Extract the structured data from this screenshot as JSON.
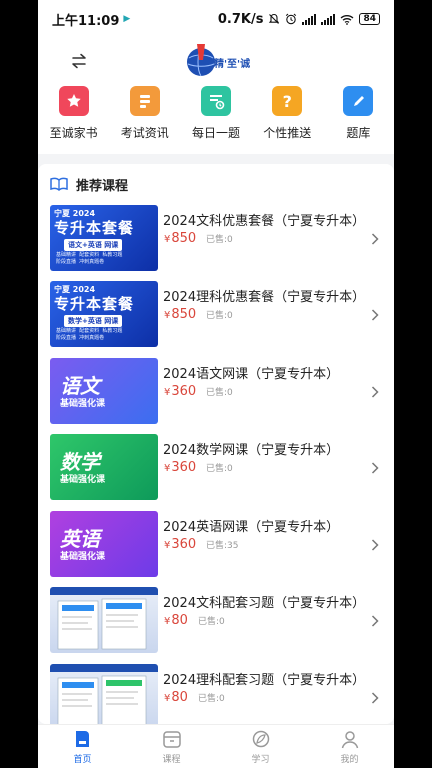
{
  "status": {
    "time": "上午11:09",
    "speed": "0.7K/s",
    "battery": "84"
  },
  "header": {
    "logo_text": "精'至'诚"
  },
  "quicknav": [
    {
      "label": "至诚家书",
      "icon": "star-book-icon",
      "color": "#f0475b"
    },
    {
      "label": "考试资讯",
      "icon": "news-icon",
      "color": "#f39a3b"
    },
    {
      "label": "每日一题",
      "icon": "daily-question-icon",
      "color": "#2ec4a0"
    },
    {
      "label": "个性推送",
      "icon": "question-mark-icon",
      "color": "#f5a623"
    },
    {
      "label": "题库",
      "icon": "pencil-book-icon",
      "color": "#2e8ef0"
    }
  ],
  "recommend": {
    "title": "推荐课程"
  },
  "courses": [
    {
      "title": "2024文科优惠套餐（宁夏专升本）",
      "price": "850",
      "currency": "¥",
      "sold": "已售:0",
      "thumb": {
        "top": "宁夏 2024",
        "big": "专升本套餐",
        "tag": "语文+英语 网课",
        "lines": "基础精讲  配套资料  私教习题\n阶段直播  冲刺真题卷"
      }
    },
    {
      "title": "2024理科优惠套餐（宁夏专升本）",
      "price": "850",
      "currency": "¥",
      "sold": "已售:0",
      "thumb": {
        "top": "宁夏 2024",
        "big": "专升本套餐",
        "tag": "数学+英语 网课",
        "lines": "基础精讲  配套资料  私教习题\n阶段直播  冲刺真题卷"
      }
    },
    {
      "title": "2024语文网课（宁夏专升本）",
      "price": "360",
      "currency": "¥",
      "sold": "已售:0",
      "thumb": {
        "subject": "语文",
        "sub": "基础强化课"
      }
    },
    {
      "title": "2024数学网课（宁夏专升本）",
      "price": "360",
      "currency": "¥",
      "sold": "已售:0",
      "thumb": {
        "subject": "数学",
        "sub": "基础强化课"
      }
    },
    {
      "title": "2024英语网课（宁夏专升本）",
      "price": "360",
      "currency": "¥",
      "sold": "已售:35",
      "thumb": {
        "subject": "英语",
        "sub": "基础强化课"
      }
    },
    {
      "title": "2024文科配套习题（宁夏专升本）",
      "price": "80",
      "currency": "¥",
      "sold": "已售:0",
      "thumb": {
        "subject": "",
        "sub": ""
      }
    },
    {
      "title": "2024理科配套习题（宁夏专升本）",
      "price": "80",
      "currency": "¥",
      "sold": "已售:0",
      "thumb": {
        "subject": "",
        "sub": ""
      }
    }
  ],
  "tabs": [
    {
      "label": "首页",
      "icon": "home-icon",
      "active": true
    },
    {
      "label": "课程",
      "icon": "course-icon",
      "active": false
    },
    {
      "label": "学习",
      "icon": "study-icon",
      "active": false
    },
    {
      "label": "我的",
      "icon": "profile-icon",
      "active": false
    }
  ]
}
